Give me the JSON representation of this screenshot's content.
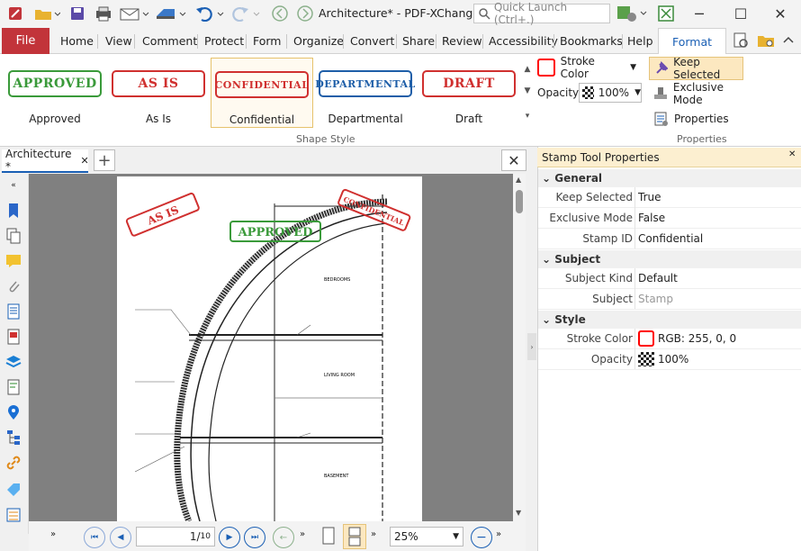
{
  "app": {
    "title": "Architecture* - PDF-XChange E..."
  },
  "search": {
    "placeholder": "Quick Launch (Ctrl+.)"
  },
  "menu": {
    "file": "File",
    "tabs": [
      "Home",
      "View",
      "Comment",
      "Protect",
      "Form",
      "Organize",
      "Convert",
      "Share",
      "Review",
      "Accessibility",
      "Bookmarks",
      "Help"
    ],
    "active_tab": "Format"
  },
  "ribbon": {
    "stamps": [
      {
        "name": "Approved",
        "text": "APPROVED",
        "color": "#3a9a3a"
      },
      {
        "name": "As Is",
        "text": "AS IS",
        "color": "#d0302f"
      },
      {
        "name": "Confidential",
        "text": "CONFIDENTIAL",
        "color": "#d0302f"
      },
      {
        "name": "Departmental",
        "text": "DEPARTMENTAL",
        "color": "#1e5ea8"
      },
      {
        "name": "Draft",
        "text": "DRAFT",
        "color": "#d0302f"
      }
    ],
    "shape_style_label": "Shape Style",
    "stroke_color_label": "Stroke Color",
    "opacity_label": "Opacity:",
    "opacity_value": "100%",
    "keep_selected": "Keep Selected",
    "exclusive_mode": "Exclusive Mode",
    "properties": "Properties",
    "properties_group": "Properties"
  },
  "document": {
    "tab_name": "Architecture *",
    "drawing": {
      "as_is": "AS IS",
      "approved": "APPROVED",
      "confidential": "CONFIDENTIAL",
      "bedrooms": "BEDROOMS",
      "living_room": "LIVING ROOM",
      "basement": "BASEMENT"
    }
  },
  "status": {
    "page_current": "1",
    "page_total": "10",
    "zoom": "25%"
  },
  "panel": {
    "title": "Stamp Tool Properties",
    "sections": {
      "general": "General",
      "subject": "Subject",
      "style": "Style"
    },
    "props": {
      "keep_selected": {
        "name": "Keep Selected",
        "value": "True"
      },
      "exclusive_mode": {
        "name": "Exclusive Mode",
        "value": "False"
      },
      "stamp_id": {
        "name": "Stamp ID",
        "value": "Confidential"
      },
      "subject_kind": {
        "name": "Subject Kind",
        "value": "Default"
      },
      "subject": {
        "name": "Subject",
        "value": "Stamp"
      },
      "stroke_color": {
        "name": "Stroke Color",
        "value": "RGB: 255, 0, 0"
      },
      "opacity": {
        "name": "Opacity",
        "value": "100%"
      }
    }
  },
  "colors": {
    "accent": "#1a5fb4",
    "file_tab": "#c2343a",
    "stroke": "#ff0000"
  }
}
